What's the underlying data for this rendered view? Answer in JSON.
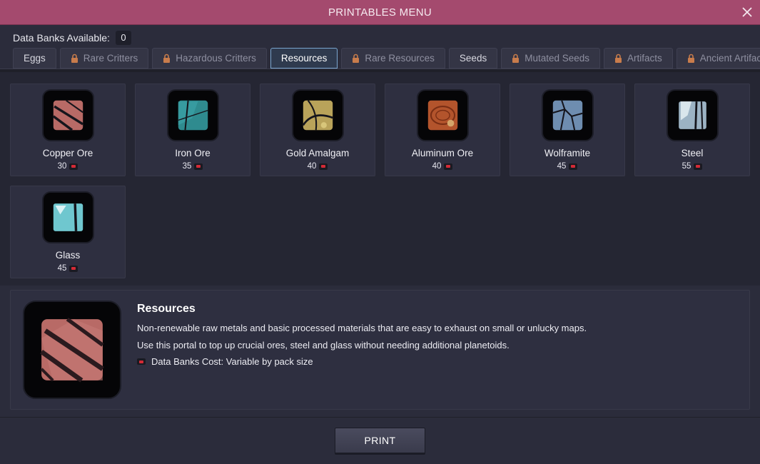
{
  "window": {
    "title": "PRINTABLES MENU",
    "close_icon": "close-icon"
  },
  "databanks": {
    "label": "Data Banks Available:",
    "count": "0"
  },
  "tabs": [
    {
      "label": "Eggs",
      "locked": false,
      "active": false
    },
    {
      "label": "Rare Critters",
      "locked": true,
      "active": false
    },
    {
      "label": "Hazardous Critters",
      "locked": true,
      "active": false
    },
    {
      "label": "Resources",
      "locked": false,
      "active": true
    },
    {
      "label": "Rare Resources",
      "locked": true,
      "active": false
    },
    {
      "label": "Seeds",
      "locked": false,
      "active": false
    },
    {
      "label": "Mutated Seeds",
      "locked": true,
      "active": false
    },
    {
      "label": "Artifacts",
      "locked": true,
      "active": false
    },
    {
      "label": "Ancient Artifacts",
      "locked": true,
      "active": false
    }
  ],
  "items": [
    {
      "name": "Copper Ore",
      "cost": "30",
      "icon": "copper-ore-icon",
      "color": "#b86a66"
    },
    {
      "name": "Iron Ore",
      "cost": "35",
      "icon": "iron-ore-icon",
      "color": "#2f8b8f"
    },
    {
      "name": "Gold Amalgam",
      "cost": "40",
      "icon": "gold-amalgam-icon",
      "color": "#b9a35a"
    },
    {
      "name": "Aluminum Ore",
      "cost": "40",
      "icon": "aluminum-ore-icon",
      "color": "#b3542c"
    },
    {
      "name": "Wolframite",
      "cost": "45",
      "icon": "wolframite-icon",
      "color": "#6e8db0"
    },
    {
      "name": "Steel",
      "cost": "55",
      "icon": "steel-icon",
      "color": "#9cb3c4"
    },
    {
      "name": "Glass",
      "cost": "45",
      "icon": "glass-icon",
      "color": "#6fc7cf"
    }
  ],
  "info": {
    "title": "Resources",
    "line1": "Non-renewable raw metals and basic processed materials that are easy to exhaust on small or unlucky maps.",
    "line2": "Use this portal to top up crucial ores, steel and glass without needing additional planetoids.",
    "cost_text": "Data Banks Cost: Variable by pack size",
    "icon": "resources-icon"
  },
  "footer": {
    "print_label": "PRINT"
  },
  "colors": {
    "title_bar": "#a44a6e",
    "active_tab_border": "#7aa6cf",
    "databank_red": "#d42a36"
  }
}
